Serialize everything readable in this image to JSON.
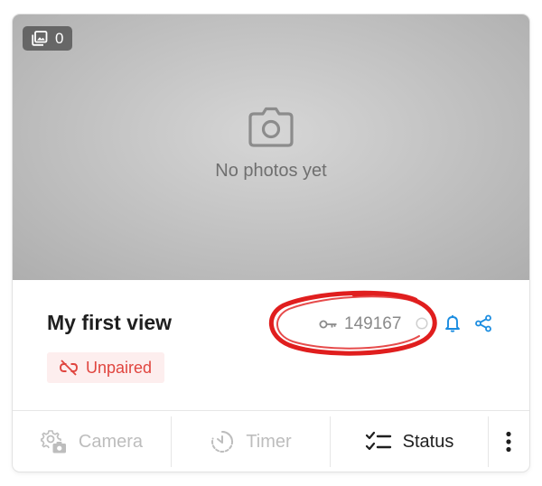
{
  "photos": {
    "count": "0",
    "empty_message": "No photos yet"
  },
  "view": {
    "title": "My first view",
    "pair_code": "149167",
    "status": "Unpaired"
  },
  "toolbar": {
    "camera_label": "Camera",
    "timer_label": "Timer",
    "status_label": "Status"
  },
  "colors": {
    "accent_blue": "#1a8ce0",
    "status_red": "#e0453f",
    "annotation_red": "#e01e1e"
  },
  "icons": {
    "photo_count": "gallery-icon",
    "empty": "camera-outline-icon",
    "code": "key-icon",
    "help": "help-circle-icon",
    "bell": "bell-icon",
    "share": "share-icon",
    "status": "link-broken-icon",
    "camera_tab": "gear-camera-icon",
    "timer_tab": "timer-icon",
    "status_tab": "checklist-icon",
    "more": "more-vertical-icon"
  }
}
